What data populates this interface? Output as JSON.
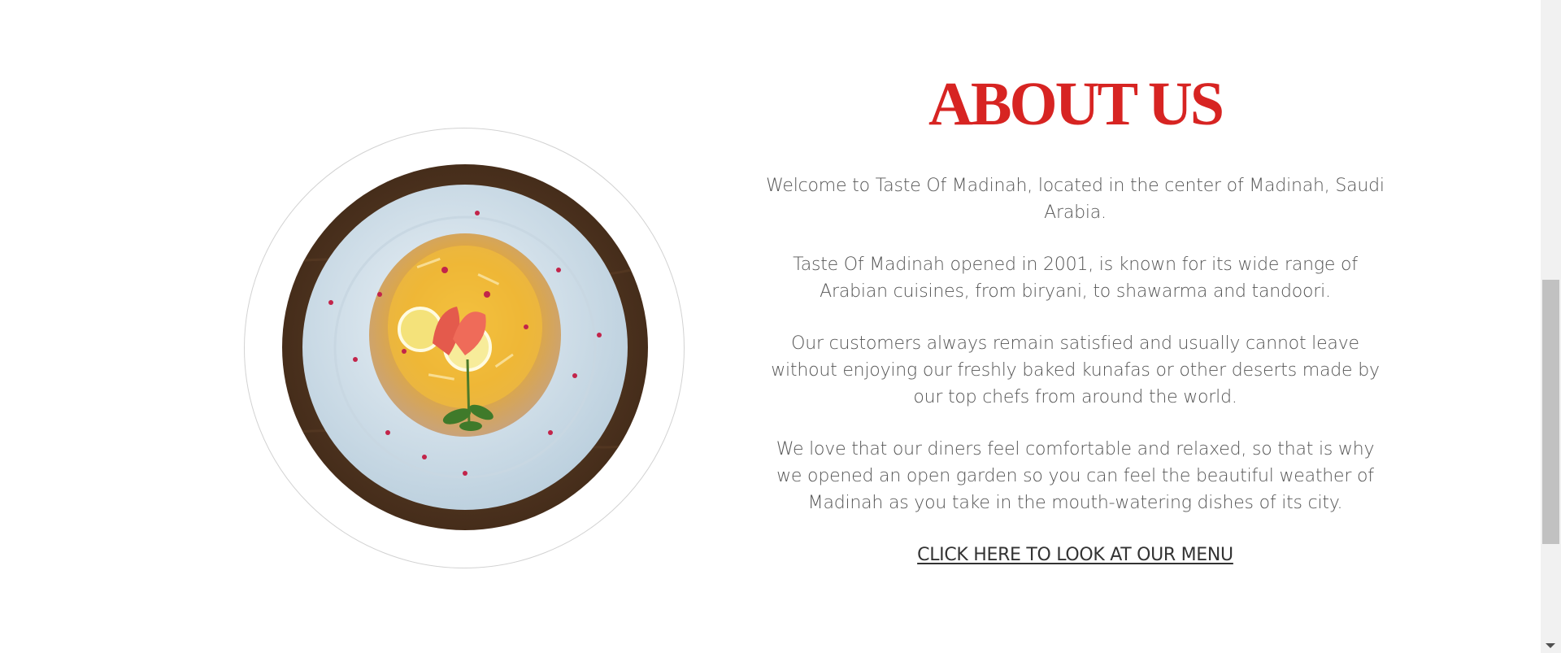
{
  "about": {
    "heading": "ABOUT US",
    "paragraphs": [
      "Welcome to Taste Of Madinah, located in the center of Madinah, Saudi Arabia.",
      "Taste Of Madinah opened in 2001, is known for its wide range of Arabian cuisines, from biryani, to shawarma and tandoori.",
      "Our customers always remain satisfied and usually cannot leave without enjoying our freshly baked kunafas or other deserts made by our top chefs from around the world.",
      "We love that our diners feel comfortable and relaxed, so that is why we opened an open garden so you can feel the beautiful weather of Madinah as you take in the mouth-watering dishes of its city."
    ],
    "menu_link": "CLICK HERE TO LOOK AT OUR MENU"
  },
  "colors": {
    "heading": "#d72422",
    "body_text": "#565656",
    "link": "#333333"
  }
}
